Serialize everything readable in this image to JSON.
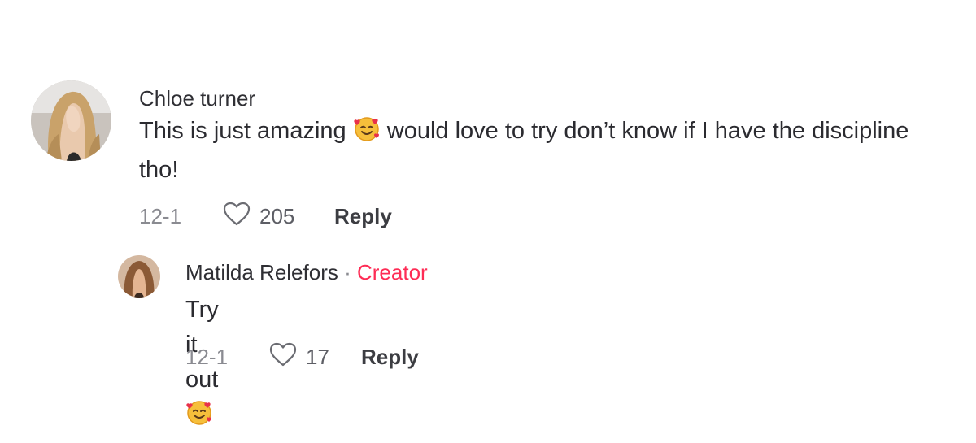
{
  "comments": [
    {
      "username": "Chloe turner",
      "text_before_emoji": "This is just amazing",
      "emoji": "smiling-face-with-hearts",
      "text_after_emoji": "would love to try don’t know if I have the discipline tho!",
      "date": "12-1",
      "likes": "205",
      "reply_label": "Reply",
      "like_icon": "heart-outline-icon"
    }
  ],
  "reply": {
    "username": "Matilda Relefors",
    "separator": "·",
    "creator_label": "Creator",
    "text": "Try it out",
    "emoji": "smiling-face-with-hearts",
    "date": "12-1",
    "likes": "17",
    "reply_label": "Reply",
    "like_icon": "heart-outline-icon"
  },
  "colors": {
    "creator_accent": "#fe2c55",
    "emoji_face": "#f6bf3b",
    "heart": "#e8314a"
  }
}
